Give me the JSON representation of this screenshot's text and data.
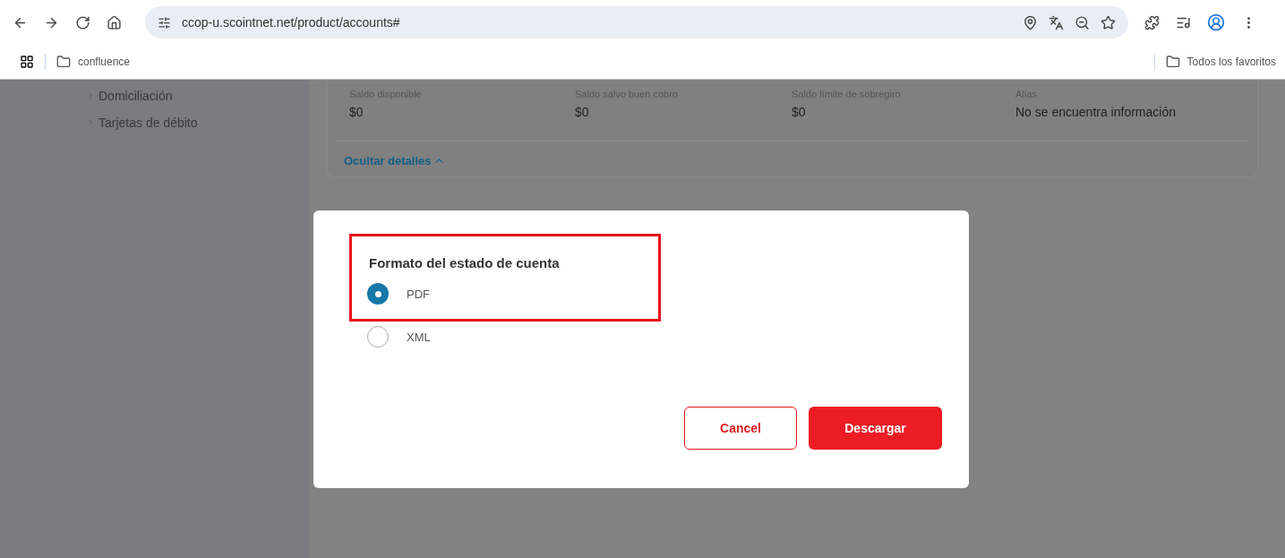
{
  "browser": {
    "url": "ccop-u.scointnet.net/product/accounts#",
    "bookmarks": [
      {
        "label": "confluence"
      }
    ],
    "all_bookmarks": "Todos los favoritos"
  },
  "sidebar": {
    "items": [
      {
        "label": "Domiciliación"
      },
      {
        "label": "Tarjetas de débito"
      }
    ]
  },
  "details": {
    "fields": [
      {
        "label": "Saldo disponible",
        "value": "$0"
      },
      {
        "label": "Saldo salvo buen cobro",
        "value": "$0"
      },
      {
        "label": "Saldo límite de sobregiro",
        "value": "$0"
      },
      {
        "label": "Alias",
        "value": "No se encuentra información"
      }
    ],
    "toggle": "Ocultar detalles"
  },
  "dialog": {
    "title": "Formato del estado de cuenta",
    "options": [
      {
        "label": "PDF",
        "selected": true
      },
      {
        "label": "XML",
        "selected": false
      }
    ],
    "buttons": [
      {
        "label": "Cancel",
        "kind": "secondary"
      },
      {
        "label": "Descargar",
        "kind": "primary"
      }
    ]
  }
}
